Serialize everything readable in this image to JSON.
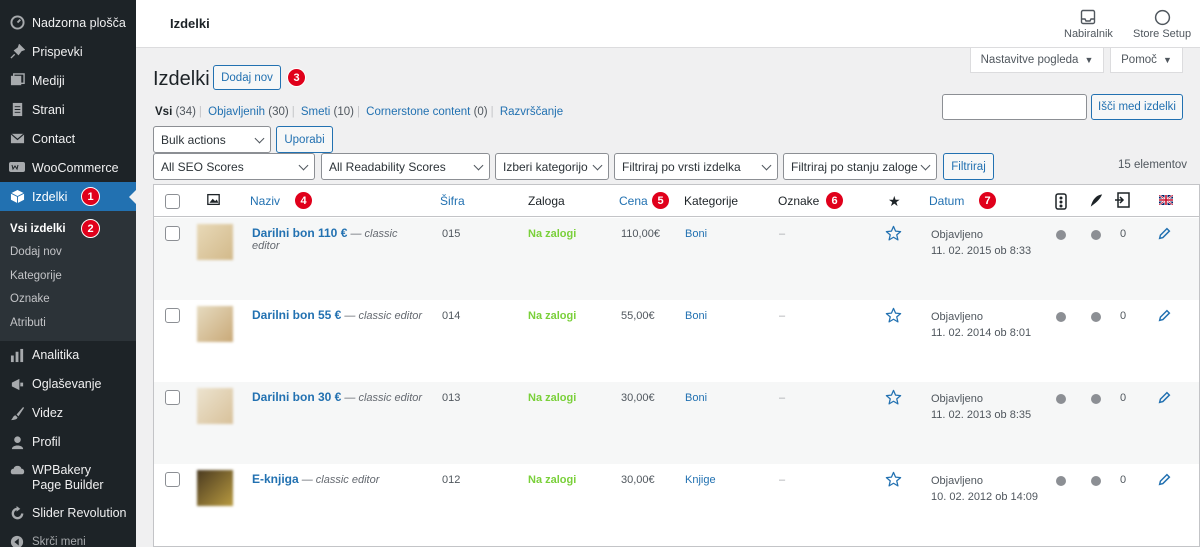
{
  "sidebar": {
    "items": [
      {
        "label": "Nadzorna plošča",
        "icon": "dashboard-icon"
      },
      {
        "label": "Prispevki",
        "icon": "pin-icon"
      },
      {
        "label": "Mediji",
        "icon": "media-icon"
      },
      {
        "label": "Strani",
        "icon": "page-icon"
      },
      {
        "label": "Contact",
        "icon": "mail-icon"
      },
      {
        "label": "WooCommerce",
        "icon": "woo-icon"
      },
      {
        "label": "Izdelki",
        "icon": "box-icon",
        "badge": "1"
      }
    ],
    "submenu": [
      {
        "label": "Vsi izdelki",
        "badge": "2"
      },
      {
        "label": "Dodaj nov"
      },
      {
        "label": "Kategorije"
      },
      {
        "label": "Oznake"
      },
      {
        "label": "Atributi"
      }
    ],
    "items_after": [
      {
        "label": "Analitika",
        "icon": "chart-icon"
      },
      {
        "label": "Oglaševanje",
        "icon": "megaphone-icon"
      },
      {
        "label": "Videz",
        "icon": "brush-icon"
      },
      {
        "label": "Profil",
        "icon": "user-icon"
      },
      {
        "label": "WPBakery Page Builder",
        "icon": "builder-icon"
      },
      {
        "label": "Slider Revolution",
        "icon": "refresh-icon"
      },
      {
        "label": "Skrči meni",
        "icon": "collapse-icon"
      }
    ]
  },
  "header": {
    "title": "Izdelki",
    "inbox_label": "Nabiralnik",
    "setup_label": "Store Setup",
    "screen_options": "Nastavitve pogleda",
    "help": "Pomoč"
  },
  "page": {
    "title": "Izdelki",
    "add_new": "Dodaj nov",
    "badge_add": "3",
    "views": [
      {
        "label": "Vsi",
        "count": "(34)"
      },
      {
        "label": "Objavljenih",
        "count": "(30)"
      },
      {
        "label": "Smeti",
        "count": "(10)"
      },
      {
        "label": "Cornerstone content",
        "count": "(0)"
      },
      {
        "label": "Razvrščanje",
        "count": ""
      }
    ],
    "search_button": "Išči med izdelki",
    "bulk_actions": "Bulk actions",
    "apply": "Uporabi",
    "filters": [
      "All SEO Scores",
      "All Readability Scores",
      "Izberi kategorijo",
      "Filtriraj po vrsti izdelka",
      "Filtriraj po stanju zaloge"
    ],
    "filter_button": "Filtriraj",
    "items_count": "15 elementov"
  },
  "table": {
    "columns": {
      "name": "Naziv",
      "sku": "Šifra",
      "stock": "Zaloga",
      "price": "Cena",
      "categories": "Kategorije",
      "tags": "Oznake",
      "date": "Datum"
    },
    "badges": {
      "name": "4",
      "price": "5",
      "tags": "6",
      "date": "7"
    },
    "rows": [
      {
        "name": "Darilni bon 110 €",
        "note": "— classic editor",
        "sku": "015",
        "stock": "Na zalogi",
        "price": "110,00€",
        "category": "Boni",
        "tags": "–",
        "status": "Objavljeno",
        "date": "11. 02. 2015 ob 8:33",
        "links": "0"
      },
      {
        "name": "Darilni bon 55 €",
        "note": "— classic editor",
        "sku": "014",
        "stock": "Na zalogi",
        "price": "55,00€",
        "category": "Boni",
        "tags": "–",
        "status": "Objavljeno",
        "date": "11. 02. 2014 ob 8:01",
        "links": "0"
      },
      {
        "name": "Darilni bon 30 €",
        "note": "— classic editor",
        "sku": "013",
        "stock": "Na zalogi",
        "price": "30,00€",
        "category": "Boni",
        "tags": "–",
        "status": "Objavljeno",
        "date": "11. 02. 2013 ob 8:35",
        "links": "0"
      },
      {
        "name": "E-knjiga",
        "note": "— classic editor",
        "sku": "012",
        "stock": "Na zalogi",
        "price": "30,00€",
        "category": "Knjige",
        "tags": "–",
        "status": "Objavljeno",
        "date": "10. 02. 2012 ob 14:09",
        "links": "0"
      }
    ]
  },
  "colors": {
    "accent": "#2271b1",
    "sidebar": "#1d2327",
    "badge": "#e0001b",
    "in_stock": "#7ad03a"
  }
}
